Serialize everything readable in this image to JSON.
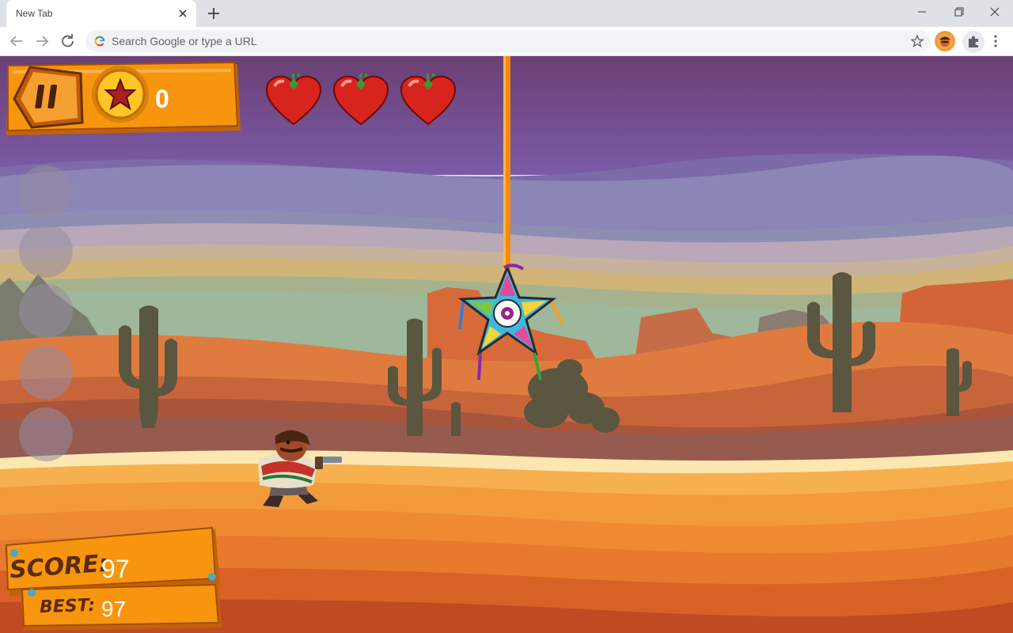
{
  "browser": {
    "tab_title": "New Tab",
    "omnibox_placeholder": "Search Google or type a URL"
  },
  "hud": {
    "coins": "0",
    "lives": 3,
    "score_label": "SCORE:",
    "score": "97",
    "best_label": "BEST:",
    "best": "97"
  },
  "side_buttons": 5,
  "colors": {
    "wood": "#f7960e",
    "wood_dark": "#c2620a",
    "sky_purple": "#7a5aa6",
    "sand": "#f0883a",
    "cactus": "#59553e"
  }
}
